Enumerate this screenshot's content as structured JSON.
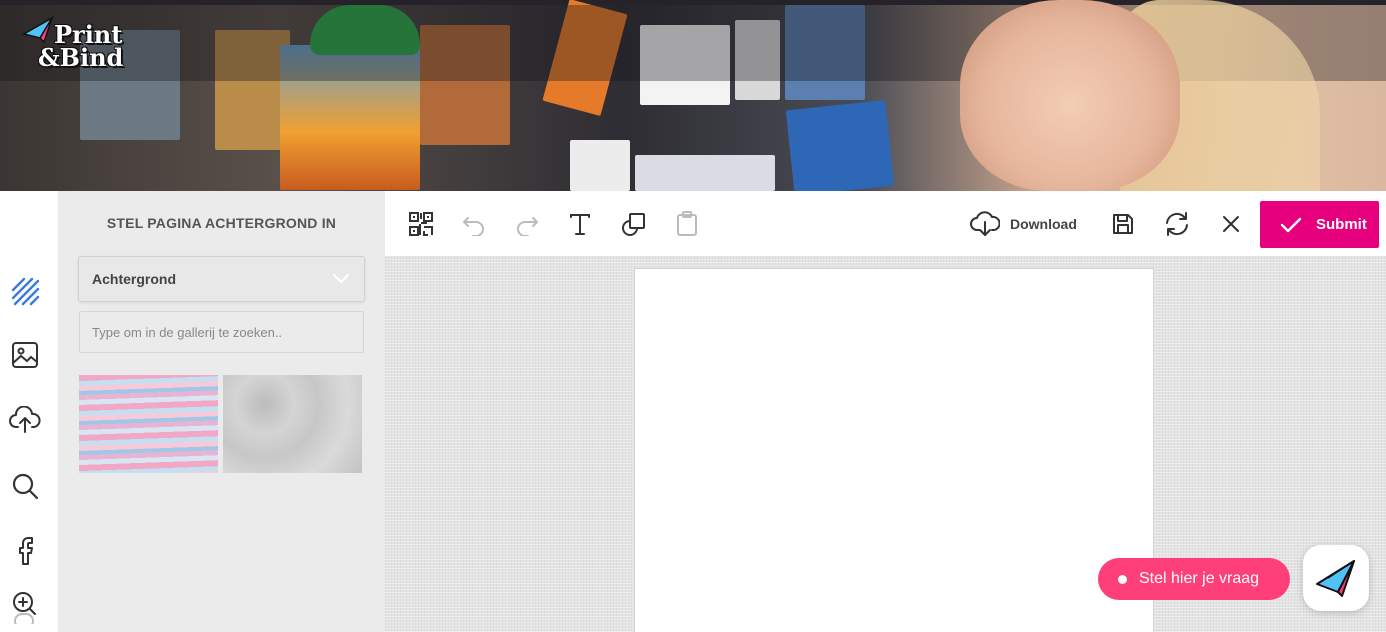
{
  "brand": {
    "line1": "Print",
    "line2": "&Bind"
  },
  "panel": {
    "title": "STEL PAGINA ACHTERGROND IN",
    "dropdown_value": "Achtergrond",
    "search_placeholder": "Type om in de gallerij te zoeken.."
  },
  "sidebar": {
    "items": [
      {
        "icon": "background-pattern-icon"
      },
      {
        "icon": "image-icon"
      },
      {
        "icon": "upload-icon"
      },
      {
        "icon": "search-icon"
      },
      {
        "icon": "facebook-icon"
      },
      {
        "icon": "zoom-in-icon"
      }
    ]
  },
  "toolbar": {
    "download_label": "Download",
    "submit_label": "Submit"
  },
  "chat": {
    "label": "Stel hier je vraag"
  },
  "colors": {
    "accent": "#e6007e",
    "rail_icon_active": "#3a7bd5",
    "chat_bubble": "#ff3f79"
  }
}
